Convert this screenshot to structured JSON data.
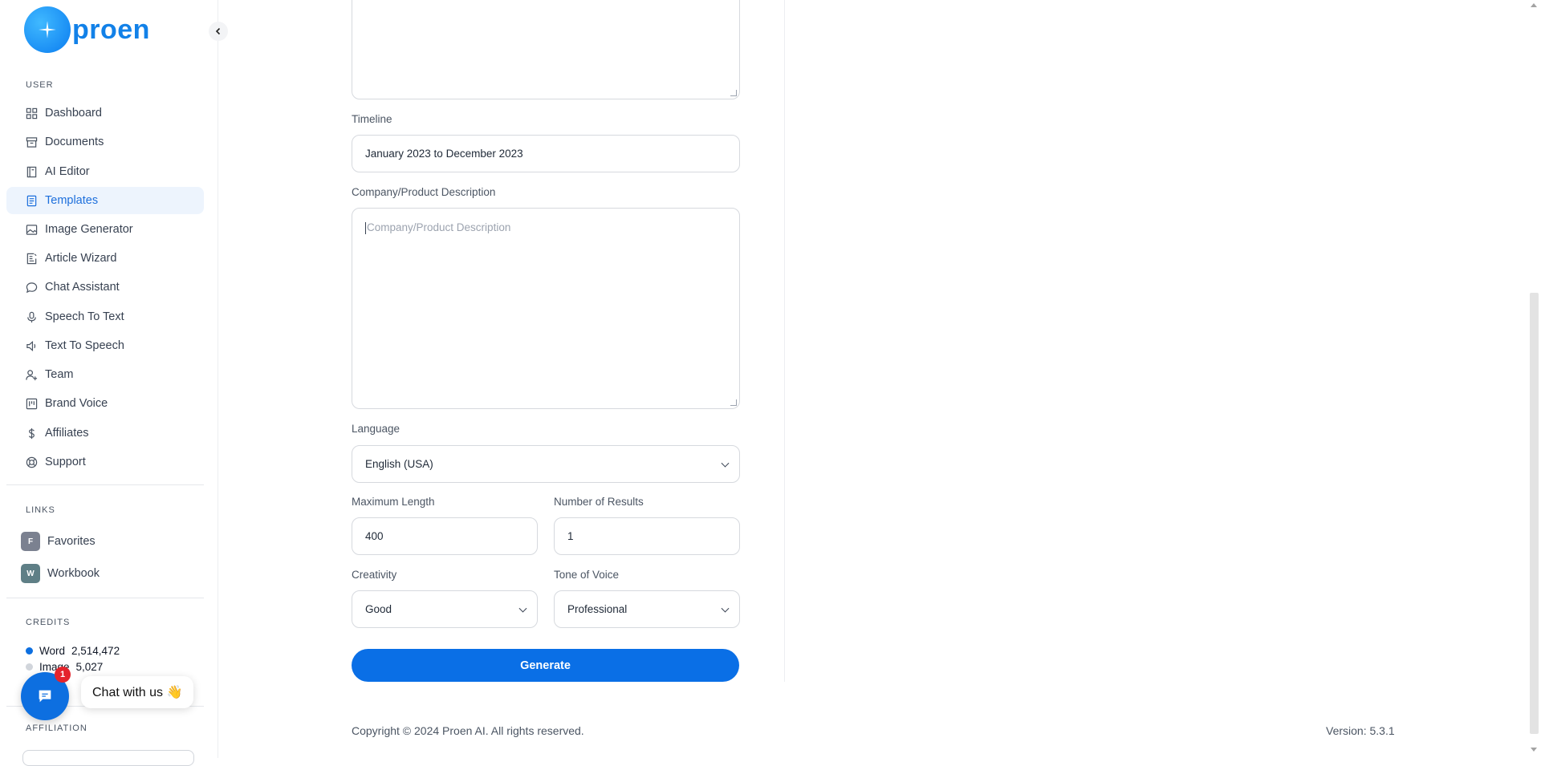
{
  "brand": {
    "name": "proen",
    "logo_icon": "sparkle-icon"
  },
  "sidebar": {
    "user_section_label": "USER",
    "items": [
      {
        "label": "Dashboard",
        "icon": "dashboard-icon"
      },
      {
        "label": "Documents",
        "icon": "archive-icon"
      },
      {
        "label": "AI Editor",
        "icon": "notebook-icon"
      },
      {
        "label": "Templates",
        "icon": "template-icon",
        "active": true
      },
      {
        "label": "Image Generator",
        "icon": "image-icon"
      },
      {
        "label": "Article Wizard",
        "icon": "article-icon"
      },
      {
        "label": "Chat Assistant",
        "icon": "chat-icon"
      },
      {
        "label": "Speech To Text",
        "icon": "microphone-icon"
      },
      {
        "label": "Text To Speech",
        "icon": "speaker-icon"
      },
      {
        "label": "Team",
        "icon": "user-plus-icon"
      },
      {
        "label": "Brand Voice",
        "icon": "brand-icon"
      },
      {
        "label": "Affiliates",
        "icon": "dollar-icon"
      },
      {
        "label": "Support",
        "icon": "lifebuoy-icon"
      }
    ],
    "links_section_label": "LINKS",
    "links": [
      {
        "badge": "F",
        "label": "Favorites",
        "color": "#7b8190"
      },
      {
        "badge": "W",
        "label": "Workbook",
        "color": "#5f7f86"
      }
    ],
    "credits_section_label": "CREDITS",
    "credits": [
      {
        "label": "Word",
        "value": "2,514,472",
        "color": "#0d6fe0"
      },
      {
        "label": "Image",
        "value": "5,027",
        "color": "#d1d5db"
      }
    ],
    "affiliation_section_label": "AFFILIATION"
  },
  "chat": {
    "badge_count": "1",
    "bubble_text": "Chat with us 👋"
  },
  "form": {
    "timeline_label": "Timeline",
    "timeline_value": "January 2023 to December 2023",
    "description_label": "Company/Product Description",
    "description_placeholder": "Company/Product Description",
    "language_label": "Language",
    "language_value": "English (USA)",
    "max_length_label": "Maximum Length",
    "max_length_value": "400",
    "num_results_label": "Number of Results",
    "num_results_value": "1",
    "creativity_label": "Creativity",
    "creativity_value": "Good",
    "tone_label": "Tone of Voice",
    "tone_value": "Professional",
    "generate_label": "Generate"
  },
  "footer": {
    "copyright": "Copyright © 2024 Proen AI. All rights reserved.",
    "version": "Version: 5.3.1"
  }
}
